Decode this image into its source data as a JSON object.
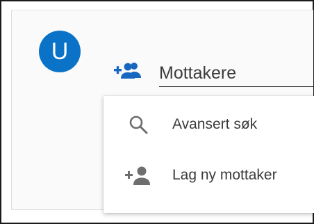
{
  "avatar": {
    "initial": "U",
    "color": "#0b73c7"
  },
  "recipients": {
    "placeholder": "Mottakere",
    "icon": "add-group-icon",
    "icon_color": "#1767c0"
  },
  "dropdown": {
    "items": [
      {
        "label": "Avansert søk",
        "icon": "search-icon"
      },
      {
        "label": "Lag ny mottaker",
        "icon": "add-person-icon"
      }
    ]
  }
}
